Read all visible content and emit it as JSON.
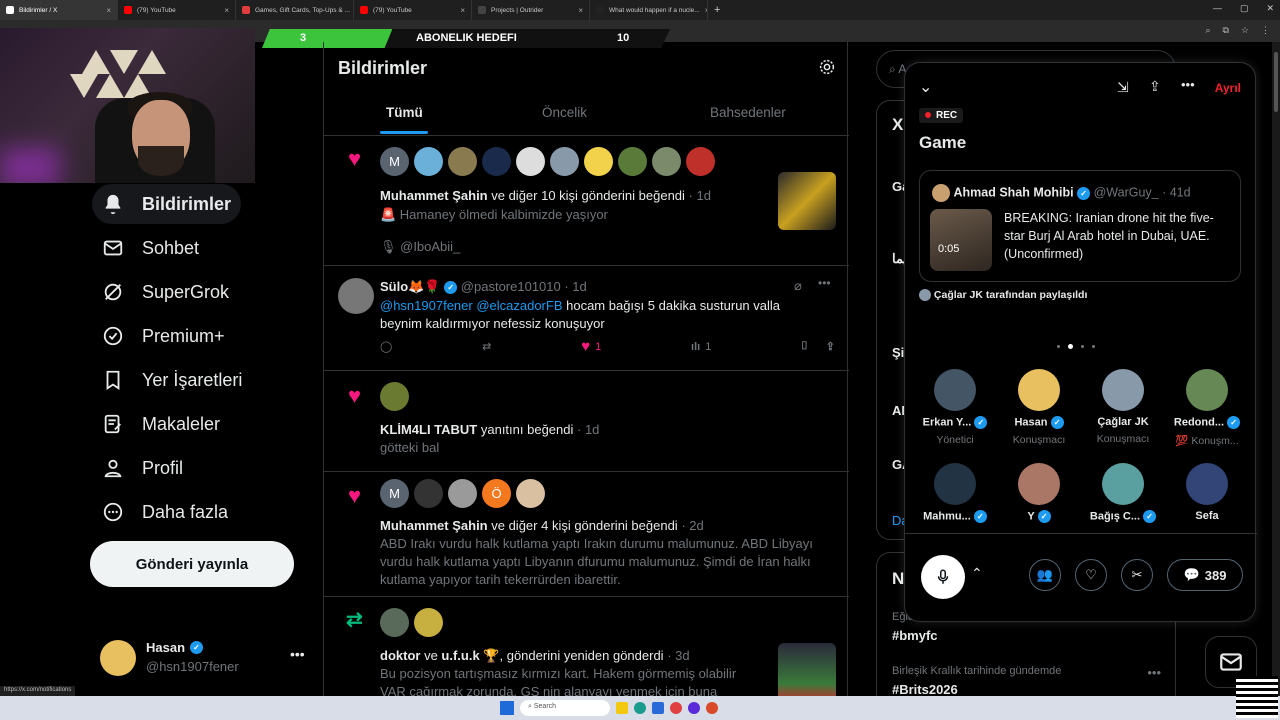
{
  "browser": {
    "tabs": [
      {
        "title": "Bildirimler / X",
        "color": "#ffffff",
        "active": true
      },
      {
        "title": "(79) YouTube",
        "color": "#ff0000"
      },
      {
        "title": "Games, Gift Cards, Top-Ups & ...",
        "color": "#e03c3c"
      },
      {
        "title": "(79) YouTube",
        "color": "#ff0000"
      },
      {
        "title": "Projects | Outrider",
        "color": "#444444"
      },
      {
        "title": "What would happen if a nucle...",
        "color": "#222222"
      }
    ],
    "status_url": "https://x.com/notifications"
  },
  "stream": {
    "sub_current": "3",
    "sub_label": "ABONELIK HEDEFI",
    "sub_goal": "10",
    "sub_fill": 0.3
  },
  "nav": {
    "items": [
      {
        "label": "Bildirimler",
        "icon": "bell-icon"
      },
      {
        "label": "Sohbet",
        "icon": "mail-icon"
      },
      {
        "label": "SuperGrok",
        "icon": "grok-icon"
      },
      {
        "label": "Premium+",
        "icon": "verified-badge-icon"
      },
      {
        "label": "Yer İşaretleri",
        "icon": "bookmark-icon"
      },
      {
        "label": "Makaleler",
        "icon": "article-icon"
      },
      {
        "label": "Profil",
        "icon": "person-icon"
      },
      {
        "label": "Daha fazla",
        "icon": "more-circle-icon"
      }
    ],
    "post_button": "Gönderi yayınla",
    "me_name": "Hasan",
    "me_handle": "@hsn1907fener"
  },
  "main": {
    "title": "Bildirimler",
    "tabs": [
      "Tümü",
      "Öncelik",
      "Bahsedenler"
    ],
    "notifications": [
      {
        "actor": "Muhammet Şahin",
        "action": " ve diğer 10 kişi gönderini beğendi",
        "time": " · 1d",
        "line1": "🚨 Hamaney ölmedi kalbimizde yaşıyor",
        "line2": "🎙 @IboAbii_"
      },
      {
        "name": "Sülo🦊🌹",
        "handle": "@pastore101010 · 1d",
        "mentions": "@hsn1907fener @elcazadorFB",
        "text_a": " hocam bağışı 5 dakika susturun valla",
        "text_b": "beynim kaldırmıyor nefessiz konuşuyor",
        "likes": "1",
        "views": "1"
      },
      {
        "actor": "KLİM4LI TABUT",
        "action": " yanıtını beğendi",
        "time": " · 1d",
        "line1": "götteki bal"
      },
      {
        "actor": "Muhammet Şahin",
        "action": " ve diğer 4 kişi gönderini beğendi",
        "time": " · 2d",
        "line1": "ABD Irakı vurdu halk kutlama yaptı Irakın durumu malumunuz. ABD Libyayı",
        "line2": "vurdu halk kutlama yaptı Libyanın dfurumu malumunuz. Şimdi de İran halkı",
        "line3": "kutlama yapıyor tarih tekerrürden ibarettir."
      },
      {
        "actor": "doktor",
        "action_mid": " ve ",
        "actor2": "u.f.u.k 🏆",
        "action": ", gönderini yeniden gönderdi",
        "time": " · 3d",
        "line1": "Bu pozisyon tartışmasız kırmızı kart. Hakem görmemiş olabilir",
        "line2": "VAR çağırmak zorunda. GS nin alanyayı yenmek için buna"
      }
    ]
  },
  "right": {
    "search_placeholder": "A",
    "trend_frag": [
      "X'",
      "Ga",
      "لیما",
      "Şir",
      "AN",
      "GA",
      "Da"
    ],
    "news_title": "Ne",
    "trends": [
      {
        "context": "Eğlence · Gündemdekiler",
        "name": "#bmyfc"
      },
      {
        "context": "Birleşik Krallık tarihinde gündemde",
        "name": "#Brits2026"
      }
    ]
  },
  "spaces": {
    "leave": "Ayrıl",
    "rec": "REC",
    "title": "Game",
    "card_name": "Ahmad Shah Mohibi",
    "card_handle": "@WarGuy_ · 41d",
    "card_duration": "0:05",
    "card_text": "BREAKING: Iranian drone hit the five-star Burj Al Arab hotel in Dubai, UAE. (Unconfirmed)",
    "shared_by": "Çağlar JK tarafından paylaşıldı",
    "speakers": [
      {
        "name": "Erkan Y...",
        "role": "Yönetici",
        "verified": true,
        "color": "#445566"
      },
      {
        "name": "Hasan",
        "role": "Konuşmacı",
        "verified": true,
        "color": "#e8c060"
      },
      {
        "name": "Çağlar JK",
        "role": "Konuşmacı",
        "verified": false,
        "color": "#8899aa"
      },
      {
        "name": "Redond...",
        "role": "💯 Konuşm...",
        "verified": true,
        "color": "#668855"
      },
      {
        "name": "Mahmu...",
        "role": "",
        "verified": true,
        "color": "#223344"
      },
      {
        "name": "Y",
        "role": "",
        "verified": true,
        "color": "#aa7766"
      },
      {
        "name": "Bağış C...",
        "role": "",
        "verified": true,
        "color": "#5aa0a0"
      },
      {
        "name": "Sefa",
        "role": "",
        "verified": false,
        "color": "#334477"
      }
    ],
    "comment_count": "389"
  }
}
